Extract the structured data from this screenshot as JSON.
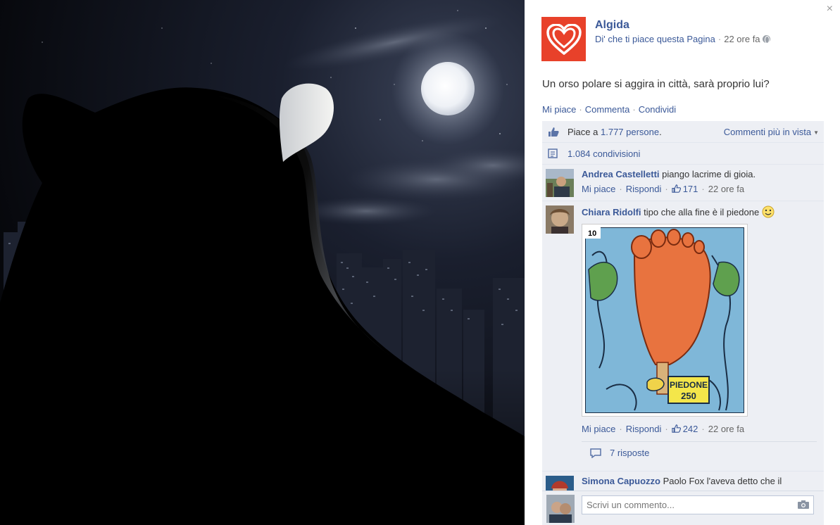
{
  "panel": {
    "close_icon": "×",
    "page_name": "Algida",
    "like_page_link": "Di' che ti piace questa Pagina",
    "time": "22 ore fa",
    "post_text": "Un orso polare si aggira in città, sarà proprio lui?",
    "actions": {
      "like": "Mi piace",
      "comment": "Commenta",
      "share": "Condividi"
    },
    "likes": {
      "prefix": "Piace a",
      "count_link": "1.777 persone",
      "suffix": "."
    },
    "sort": "Commenti più in vista",
    "shares": "1.084 condivisioni",
    "comments": [
      {
        "author": "Andrea Castelletti",
        "text": "piango lacrime di gioia.",
        "like": "Mi piace",
        "reply": "Rispondi",
        "likes": "171",
        "time": "22 ore fa"
      },
      {
        "author": "Chiara Ridolfi",
        "text": "tipo che alla fine è il piedone",
        "like": "Mi piace",
        "reply": "Rispondi",
        "likes": "242",
        "time": "22 ore fa",
        "replies": "7 risposte",
        "comic": {
          "corner_text": "10",
          "label_line1": "PIEDONE",
          "label_line2": "250"
        }
      },
      {
        "author": "Simona Capuozzo",
        "text": "Paolo Fox l'aveva detto che il"
      }
    ],
    "write_placeholder": "Scrivi un commento..."
  },
  "colors": {
    "link": "#3b5998",
    "ufi_bg": "#edeff4",
    "brand": "#e8412a"
  }
}
